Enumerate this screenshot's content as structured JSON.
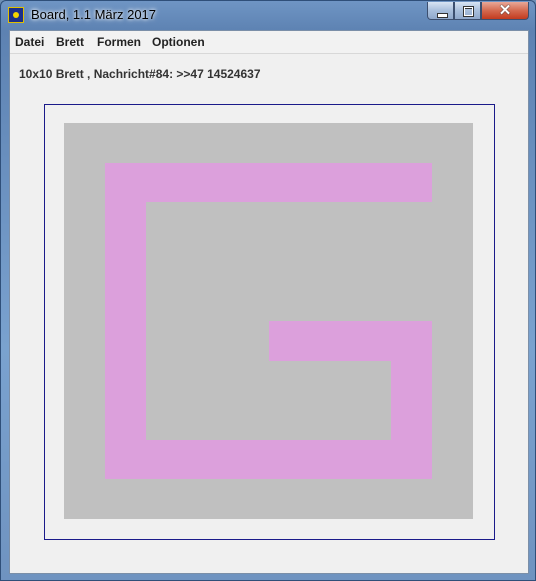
{
  "window": {
    "title": "Board, 1.1 März 2017",
    "controls": {
      "minimize": "minimize",
      "maximize": "maximize",
      "close": "✕"
    }
  },
  "menubar": {
    "items": [
      "Datei",
      "Brett",
      "Formen",
      "Optionen"
    ]
  },
  "status": {
    "message": "10x10 Brett , Nachricht#84: >>47 14524637"
  },
  "board": {
    "rows": 10,
    "cols": 10,
    "background_color": "#c0c0c0",
    "shape_color": "#dca0dc",
    "frame_color": "#1a1a8a",
    "shape_cells": [
      [
        1,
        1
      ],
      [
        1,
        2
      ],
      [
        1,
        3
      ],
      [
        1,
        4
      ],
      [
        1,
        5
      ],
      [
        1,
        6
      ],
      [
        1,
        7
      ],
      [
        1,
        8
      ],
      [
        2,
        1
      ],
      [
        3,
        1
      ],
      [
        4,
        1
      ],
      [
        5,
        1
      ],
      [
        6,
        1
      ],
      [
        7,
        1
      ],
      [
        8,
        1
      ],
      [
        8,
        2
      ],
      [
        8,
        3
      ],
      [
        8,
        4
      ],
      [
        8,
        5
      ],
      [
        8,
        6
      ],
      [
        8,
        7
      ],
      [
        8,
        8
      ],
      [
        7,
        8
      ],
      [
        6,
        8
      ],
      [
        5,
        8
      ],
      [
        5,
        5
      ],
      [
        5,
        6
      ],
      [
        5,
        7
      ]
    ]
  }
}
